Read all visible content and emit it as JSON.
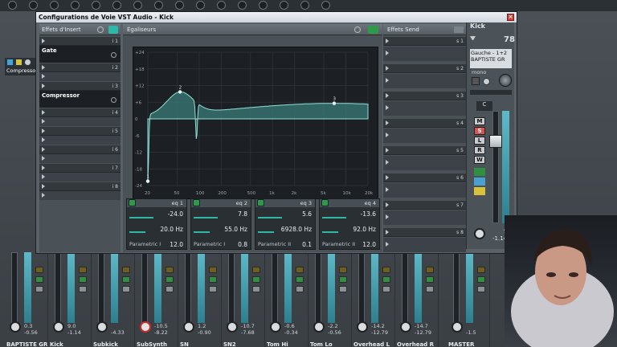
{
  "window": {
    "title": "Configurations de Voie VST Audio - Kick"
  },
  "inserts": {
    "header": "Effets d'Insert",
    "slots": [
      {
        "num": "i 1",
        "name": "Gate"
      },
      {
        "num": "i 2",
        "name": ""
      },
      {
        "num": "i 3",
        "name": "Compressor"
      },
      {
        "num": "i 4",
        "name": ""
      },
      {
        "num": "i 5",
        "name": ""
      },
      {
        "num": "i 6",
        "name": ""
      },
      {
        "num": "i 7",
        "name": ""
      },
      {
        "num": "i 8",
        "name": ""
      }
    ]
  },
  "eq": {
    "header": "Égaliseurs",
    "y_ticks": [
      "+24",
      "+18",
      "+12",
      "+6",
      "0",
      "-6",
      "-12",
      "-18",
      "-24"
    ],
    "x_ticks": [
      "20",
      "50",
      "100",
      "200",
      "500",
      "1k",
      "2k",
      "5k",
      "10k",
      "20k"
    ],
    "point_labels": [
      "2",
      "1",
      "3"
    ],
    "bands": [
      {
        "label": "eq 1",
        "gain": "-24.0",
        "freq": "20.0 Hz",
        "type": "Parametric I",
        "q": "12.0"
      },
      {
        "label": "eq 2",
        "gain": "7.8",
        "freq": "55.0 Hz",
        "type": "Parametric I",
        "q": "0.8"
      },
      {
        "label": "eq 3",
        "gain": "5.6",
        "freq": "6928.0 Hz",
        "type": "Parametric II",
        "q": "0.1"
      },
      {
        "label": "eq 4",
        "gain": "-13.6",
        "freq": "92.0 Hz",
        "type": "Parametric II",
        "q": "12.0"
      }
    ]
  },
  "sends": {
    "header": "Effets Send",
    "slots": [
      "s 1",
      "s 2",
      "s 3",
      "s 4",
      "s 5",
      "s 6",
      "s 7",
      "s 8"
    ]
  },
  "channel": {
    "name": "Kick",
    "number": "78",
    "routing": "Gauche - 1+2",
    "output": "BAPTISTE GR",
    "mode": "mono",
    "pan": "C",
    "fader_value": "-1.14",
    "meter_value": "9"
  },
  "left_plugin": {
    "name": "Compresso"
  },
  "mixer": {
    "channels": [
      {
        "name": "BAPTISTE GR",
        "peak": "0.3",
        "value": "-0.56"
      },
      {
        "name": "Kick",
        "peak": "9.0",
        "value": "-1.14"
      },
      {
        "name": "Subkick",
        "peak": "",
        "value": "-4.33"
      },
      {
        "name": "SubSynth",
        "peak": "-10.5",
        "value": "-8.22"
      },
      {
        "name": "SN",
        "peak": "1.2",
        "value": "-0.90"
      },
      {
        "name": "SN2",
        "peak": "-10.7",
        "value": "-7.68"
      },
      {
        "name": "Tom Hi",
        "peak": "-0.6",
        "value": "-0.34"
      },
      {
        "name": "Tom Lo",
        "peak": "-2.2",
        "value": "-0.56"
      },
      {
        "name": "Overhead L",
        "peak": "-14.2",
        "value": "-12.79"
      },
      {
        "name": "Overhead R",
        "peak": "-14.7",
        "value": "-12.79"
      },
      {
        "name": "MASTER",
        "peak": "",
        "value": "-1.5"
      }
    ]
  },
  "colors": {
    "accent": "#2fb7a8",
    "panel": "#1c2024",
    "titlebar": "#cfd6de"
  }
}
